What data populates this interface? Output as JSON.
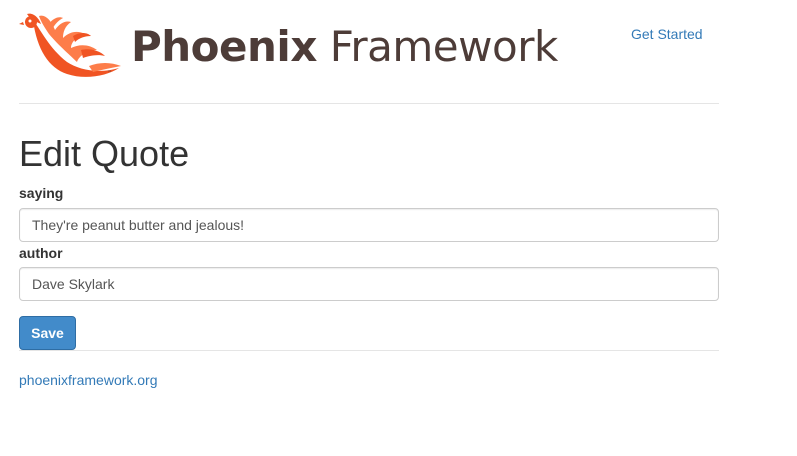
{
  "header": {
    "logo": {
      "strong_text": "Phoenix",
      "light_text": "Framework",
      "icon": "phoenix-bird-icon",
      "colors": {
        "flame_primary": "#f05423",
        "flame_secondary": "#fd7d4a",
        "text": "#4d3c38"
      }
    },
    "nav": {
      "get_started_label": "Get Started"
    }
  },
  "main": {
    "title": "Edit Quote",
    "form": {
      "saying": {
        "label": "saying",
        "value": "They're peanut butter and jealous!"
      },
      "author": {
        "label": "author",
        "value": "Dave Skylark"
      },
      "save_label": "Save"
    }
  },
  "footer": {
    "link_label": "phoenixframework.org"
  },
  "theme": {
    "link_color": "#337ab7",
    "button_color": "#428bca",
    "divider_color": "#e5e5e5"
  }
}
